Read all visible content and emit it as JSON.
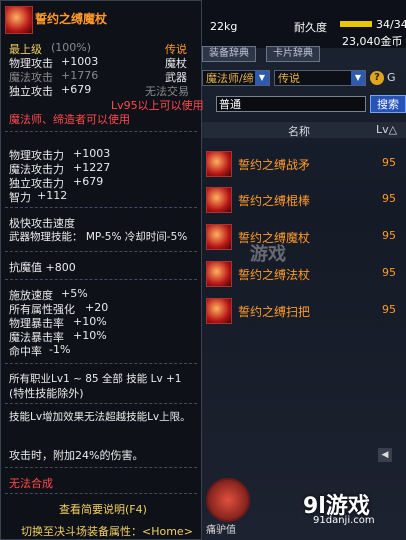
{
  "tooltip": {
    "title": "誓约之缚魔杖",
    "grade": "最上级",
    "grade_pct": "(100%)",
    "rarity": "传说",
    "type1": "魔杖",
    "type2": "武器",
    "trade": "无法交易",
    "level_req": "Lv95以上可以使用",
    "class_req": "魔法师、缔造者可以使用",
    "base": [
      {
        "label": "物理攻击",
        "value": "+1003"
      },
      {
        "label": "魔法攻击",
        "value": "+1776"
      },
      {
        "label": "独立攻击",
        "value": "+679"
      }
    ],
    "stats": [
      {
        "label": "物理攻击力",
        "value": "+1003"
      },
      {
        "label": "魔法攻击力",
        "value": "+1227"
      },
      {
        "label": "独立攻击力",
        "value": "+679"
      },
      {
        "label": "智力",
        "value": "+112"
      }
    ],
    "speed": "极快攻击速度",
    "weapon_skill": "武器物理技能：  MP-5% 冷却时间-5%",
    "anti_magic": "抗魔值 +800",
    "extra": [
      {
        "label": "施放速度",
        "value": "+5%"
      },
      {
        "label": "所有属性强化",
        "value": "+20"
      },
      {
        "label": "物理暴击率",
        "value": "+10%"
      },
      {
        "label": "魔法暴击率",
        "value": "+10%"
      },
      {
        "label": "命中率",
        "value": "-1%"
      }
    ],
    "skill_line1": "所有职业Lv1 ~ 85 全部 技能 Lv +1",
    "skill_line2": "(特性技能除外)",
    "effect1": "技能Lv增加效果无法超越技能Lv上限。",
    "effect2": "攻击时，附加24%的伤害。",
    "no_synth": "无法合成",
    "view_desc": "查看简要说明(F4)",
    "switch": "切换至决斗场装备属性：<Home>"
  },
  "panel": {
    "weight": "22kg",
    "durability_label": "耐久度",
    "durability": "34/34",
    "durability_fraction": 1.0,
    "gold": "23,040金币",
    "tabs": [
      "装备辞典",
      "卡片辞典"
    ],
    "class_select": "魔法师/缔",
    "rarity_select": "传说",
    "help_icon": "question-icon",
    "help_label": "G",
    "search_value": "普通",
    "search_btn": "搜索",
    "col_name": "名称",
    "col_lv": "Lv△",
    "items": [
      {
        "name": "誓约之缚战矛",
        "lv": "95"
      },
      {
        "name": "誓约之缚棍棒",
        "lv": "95"
      },
      {
        "name": "誓约之缚魔杖",
        "lv": "95"
      },
      {
        "name": "誓约之缚法杖",
        "lv": "95"
      },
      {
        "name": "誓约之缚扫把",
        "lv": "95"
      }
    ],
    "avatar_label": "痛驴值"
  },
  "watermark": {
    "center": "游戏",
    "brand": "9l游戏",
    "url": "91danji.com"
  },
  "colors": {
    "legend": "#ff9a2a",
    "red": "#ff4a4a",
    "yellow": "#f0d060",
    "search": "#2553b8"
  }
}
